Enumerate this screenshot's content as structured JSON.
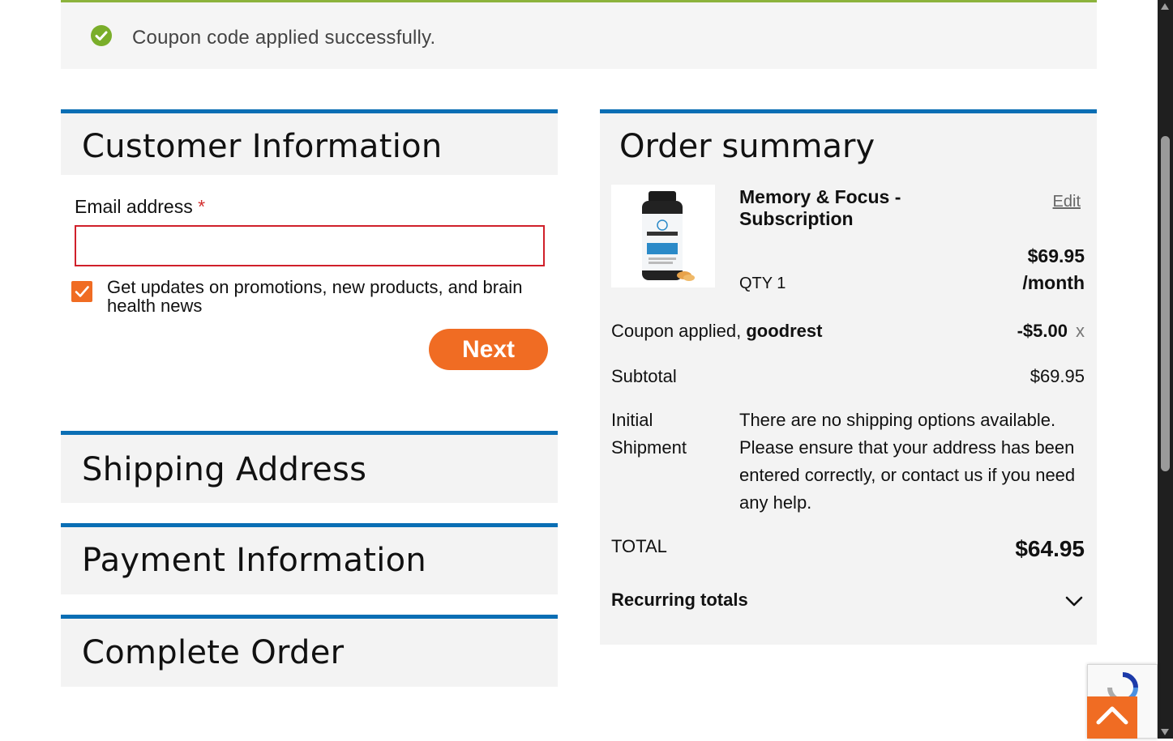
{
  "notice": {
    "message": "Coupon code applied successfully."
  },
  "sections": {
    "customer": "Customer Information",
    "shipping": "Shipping Address",
    "payment": "Payment Information",
    "complete": "Complete Order"
  },
  "customer_form": {
    "email_label": "Email address",
    "required_mark": "*",
    "email_value": "",
    "optin_label": "Get updates on promotions, new products, and brain health news",
    "optin_checked": true,
    "next_label": "Next"
  },
  "summary": {
    "title": "Order summary",
    "product": {
      "name": "Memory & Focus - Subscription",
      "edit_label": "Edit",
      "qty": "QTY 1",
      "price": "$69.95",
      "period": "/month",
      "image_icon": "product-bottle-image"
    },
    "coupon": {
      "label": "Coupon applied, ",
      "code": "goodrest",
      "amount": "-$5.00",
      "remove": "x"
    },
    "subtotal": {
      "label": "Subtotal",
      "value": "$69.95"
    },
    "shipment": {
      "label_line1": "Initial",
      "label_line2": "Shipment",
      "message": "There are no shipping options available. Please ensure that your address has been entered correctly, or contact us if you need any help."
    },
    "total": {
      "label": "TOTAL",
      "value": "$64.95"
    },
    "recurring": {
      "label": "Recurring totals",
      "icon": "chevron-down-icon"
    }
  },
  "colors": {
    "accent_blue": "#0a6eb4",
    "accent_orange": "#f06c23",
    "success_green": "#7aae2a",
    "error_red": "#d0202a"
  }
}
